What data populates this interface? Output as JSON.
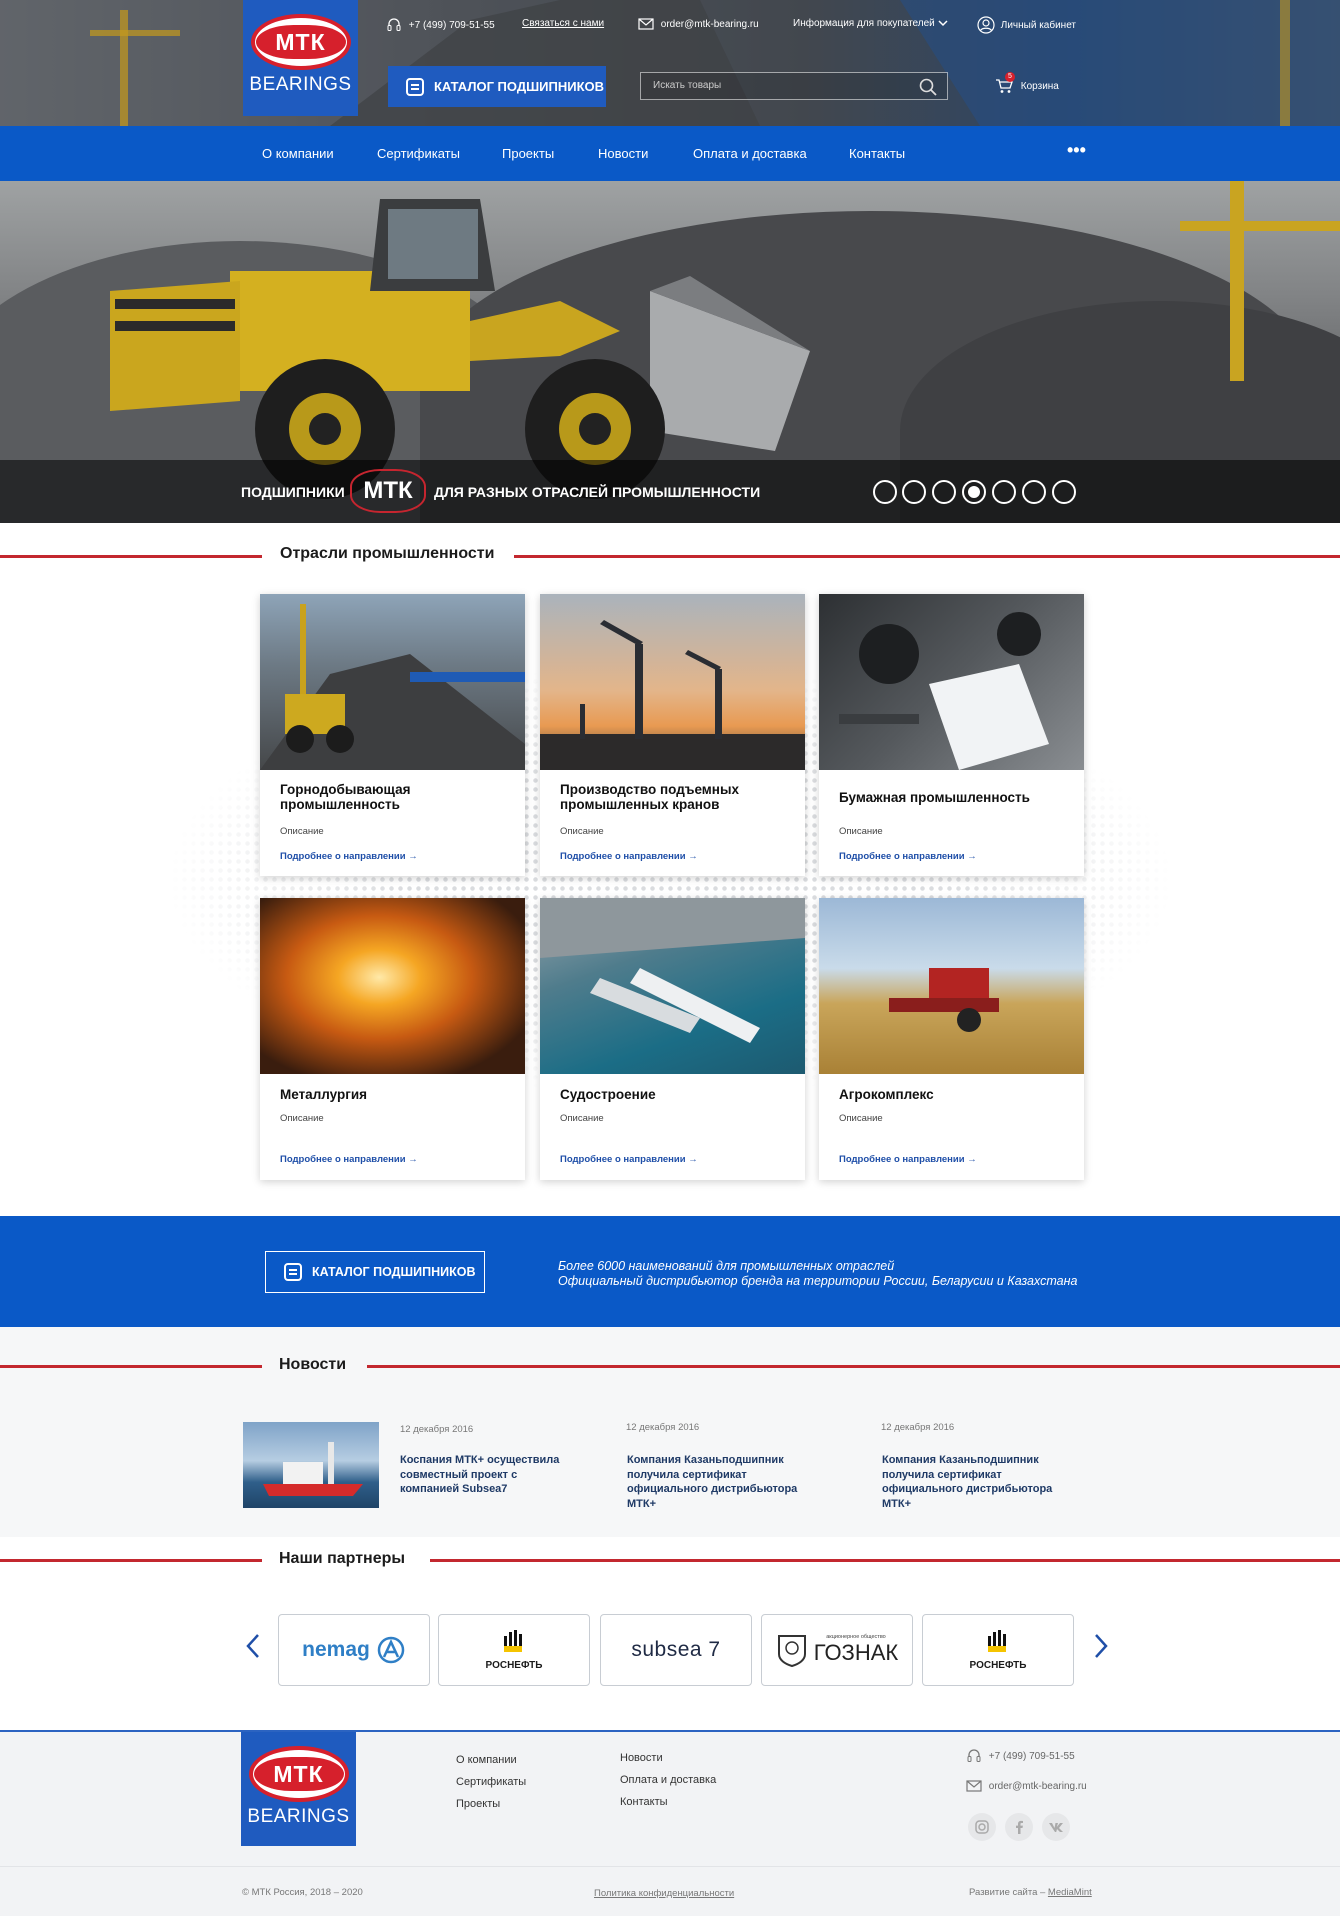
{
  "header": {
    "brand_line1": "МТК",
    "brand_line2": "BEARINGS",
    "phone": "+7 (499) 709-51-55",
    "contact_link": "Связаться с нами",
    "email": "order@mtk-bearing.ru",
    "buyers_menu": "Информация для покупателей",
    "account": "Личный кабинет",
    "catalog_button": "КАТАЛОГ ПОДШИПНИКОВ",
    "search_placeholder": "Искать товары",
    "cart_label": "Корзина",
    "cart_count": "5"
  },
  "nav": {
    "items": [
      "О компании",
      "Сертификаты",
      "Проекты",
      "Новости",
      "Оплата и доставка",
      "Контакты"
    ],
    "more": "•••"
  },
  "hero": {
    "text_left": "ПОДШИПНИКИ",
    "logo": "МТК",
    "text_right": "ДЛЯ РАЗНЫХ ОТРАСЛЕЙ ПРОМЫШЛЕННОСТИ",
    "slides_total": 7,
    "active_slide": 4
  },
  "industries": {
    "title": "Отрасли промышленности",
    "cards": [
      {
        "title": "Горнодобывающая промышленность",
        "desc": "Описание",
        "link": "Подробнее о направлении →"
      },
      {
        "title": "Производство подъемных промышленных кранов",
        "desc": "Описание",
        "link": "Подробнее о направлении →"
      },
      {
        "title": "Бумажная промышленность",
        "desc": "Описание",
        "link": "Подробнее о направлении →"
      },
      {
        "title": "Металлургия",
        "desc": "Описание",
        "link": "Подробнее о направлении →"
      },
      {
        "title": "Судостроение",
        "desc": "Описание",
        "link": "Подробнее о направлении →"
      },
      {
        "title": "Агрокомплекс",
        "desc": "Описание",
        "link": "Подробнее о направлении →"
      }
    ]
  },
  "catalog_banner": {
    "button": "КАТАЛОГ ПОДШИПНИКОВ",
    "line1": "Более 6000 наименований для промышленных отраслей",
    "line2": "Официальный дистрибьютор бренда на территории России, Беларусии и Казахстана"
  },
  "news": {
    "title": "Новости",
    "items": [
      {
        "date": "12 декабря 2016",
        "title": "Коспания МТК+ осуществила совместный проект с компанией Subsea7"
      },
      {
        "date": "12 декабря 2016",
        "title": "Компания Казаньподшипник получила сертификат официального дистрибьютора МТК+"
      },
      {
        "date": "12 декабря 2016",
        "title": "Компания Казаньподшипник получила сертификат официального дистрибьютора МТК+"
      }
    ]
  },
  "partners": {
    "title": "Наши партнеры",
    "logos": [
      "nemag",
      "РОСНЕФТЬ",
      "subsea 7",
      "ГОЗНАК",
      "РОСНЕФТЬ"
    ],
    "goznak_caption": "акционерное общество"
  },
  "footer": {
    "col1": [
      "О компании",
      "Сертификаты",
      "Проекты"
    ],
    "col2": [
      "Новости",
      "Оплата и доставка",
      "Контакты"
    ],
    "phone": "+7 (499) 709-51-55",
    "email": "order@mtk-bearing.ru",
    "social": [
      "instagram-icon",
      "facebook-icon",
      "vk-icon"
    ],
    "copyright": "© МТК Россия, 2018 – 2020",
    "privacy": "Политика конфиденциальности",
    "dev_prefix": "Развитие сайта –",
    "dev_name": "MediaMint"
  },
  "colors": {
    "brand_blue": "#0a59c7",
    "accent_red": "#c3282f",
    "logo_red": "#d6202c"
  }
}
